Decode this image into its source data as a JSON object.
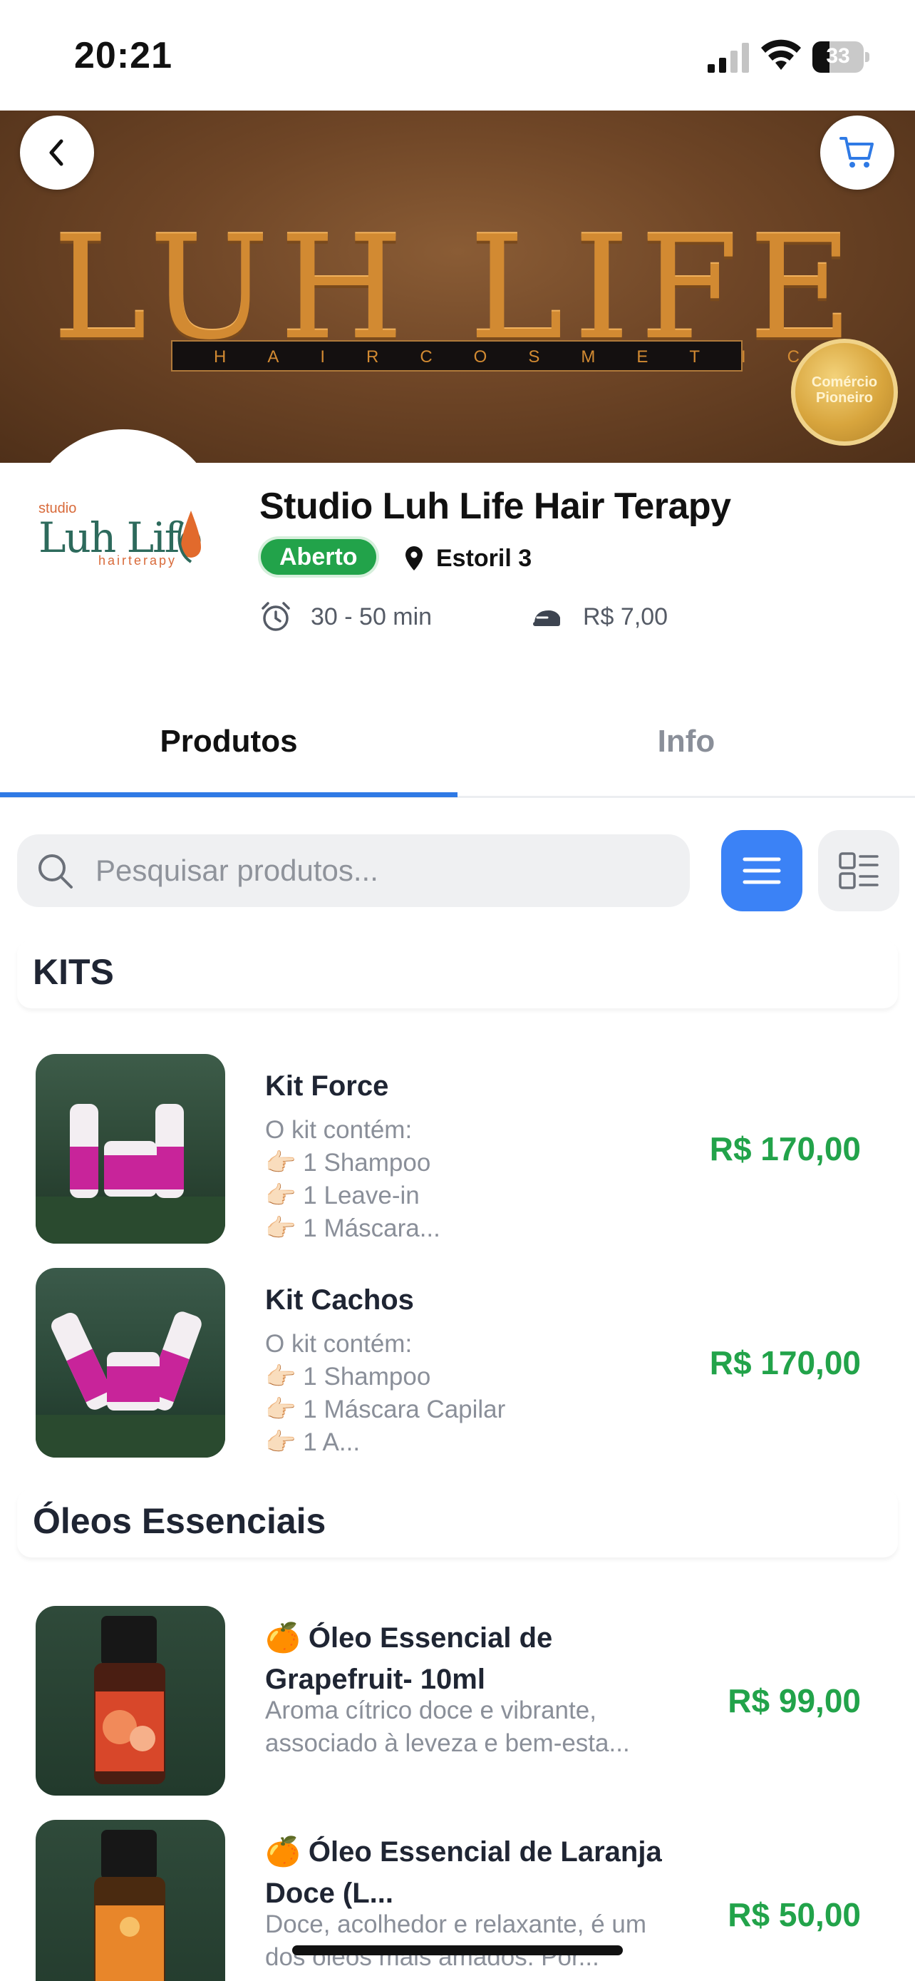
{
  "status_bar": {
    "time": "20:21",
    "battery": "33"
  },
  "banner": {
    "brand": "LUH LIFE",
    "tagline": "HAIRCOSMETICS",
    "seal": "Comércio Pioneiro"
  },
  "store": {
    "logo_studio": "studio",
    "logo_main": "Luh Life",
    "logo_sub": "hairterapy",
    "name": "Studio Luh Life Hair Terapy",
    "status": "Aberto",
    "location": "Estoril 3",
    "delivery_time": "30 - 50 min",
    "delivery_fee": "R$ 7,00"
  },
  "tabs": [
    {
      "label": "Produtos",
      "active": true
    },
    {
      "label": "Info",
      "active": false
    }
  ],
  "search": {
    "placeholder": "Pesquisar produtos..."
  },
  "sections": [
    {
      "title": "KITS",
      "products": [
        {
          "name": "Kit Force",
          "description": "O kit contém:\n👉🏻 1 Shampoo\n👉🏻 1 Leave-in\n👉🏻 1 Máscara...",
          "price": "R$ 170,00"
        },
        {
          "name": "Kit Cachos",
          "description": "O kit contém:\n👉🏻 1 Shampoo\n👉🏻 1 Máscara Capilar\n👉🏻 1 A...",
          "price": "R$ 170,00"
        }
      ]
    },
    {
      "title": "Óleos Essenciais",
      "products": [
        {
          "name": "🍊 Óleo Essencial de Grapefruit- 10ml",
          "description": "Aroma cítrico doce e vibrante, associado à leveza e bem-esta...",
          "price": "R$ 99,00"
        },
        {
          "name": "🍊 Óleo Essencial de Laranja Doce (L...",
          "description": "Doce, acolhedor e relaxante, é um dos óleos mais amados. Por...",
          "price": "R$ 50,00"
        }
      ]
    }
  ],
  "colors": {
    "accent": "#3b82f6",
    "price": "#22a34a",
    "open_badge": "#22a34a"
  }
}
